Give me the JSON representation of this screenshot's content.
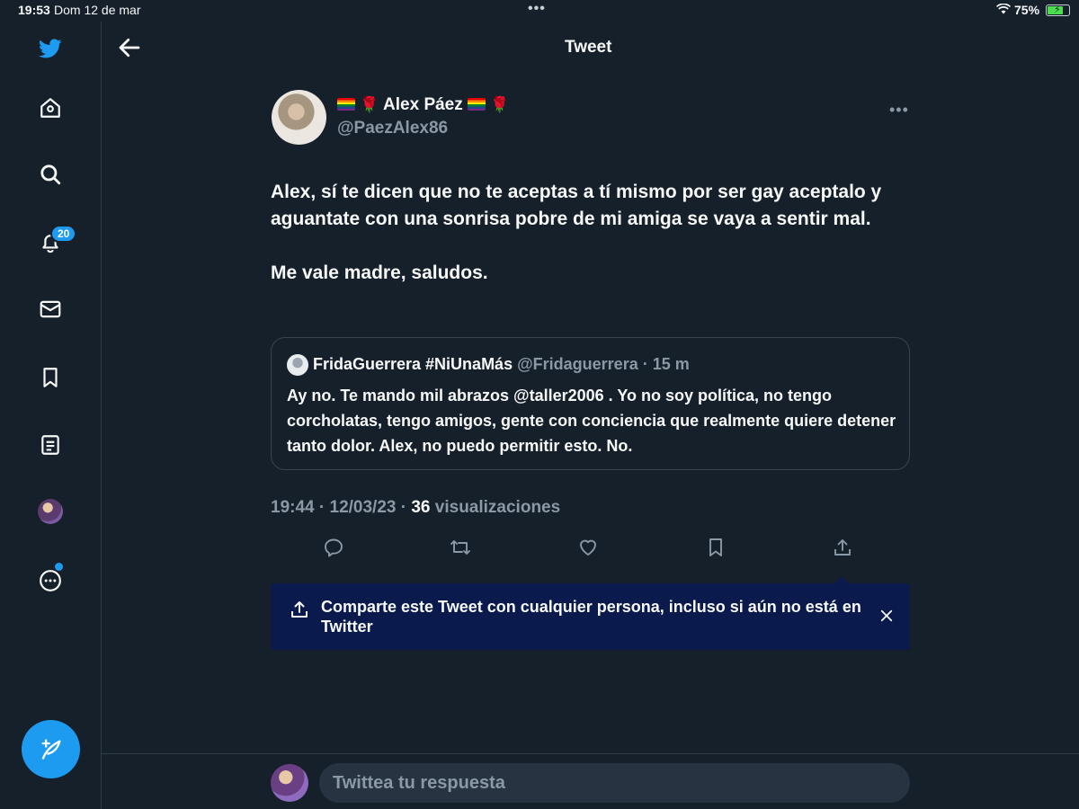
{
  "status_bar": {
    "time": "19:53",
    "date": "Dom 12 de mar",
    "battery_percent": "75%",
    "battery_level": 0.75
  },
  "sidebar": {
    "notification_count": "20"
  },
  "header": {
    "title": "Tweet"
  },
  "tweet": {
    "display_name": "Alex Páez",
    "handle": "@PaezAlex86",
    "text": "Alex, sí te dicen que no te aceptas a tí mismo por ser gay aceptalo y aguantate con una sonrisa pobre de mi amiga se vaya a sentir mal.\n\nMe vale madre, saludos.",
    "time": "19:44",
    "date": "12/03/23",
    "views_count": "36",
    "views_label": "visualizaciones"
  },
  "quoted_tweet": {
    "display_name": "FridaGuerrera #NiUnaMás",
    "handle": "@Fridaguerrera",
    "age": "15 m",
    "text": "Ay no. Te mando mil abrazos @taller2006 . Yo no soy política, no tengo corcholatas, tengo amigos, gente con conciencia que realmente quiere detener tanto dolor. Alex, no puedo permitir esto. No."
  },
  "share_banner": {
    "text": "Comparte este Tweet con cualquier persona, incluso si aún no está en Twitter"
  },
  "reply": {
    "placeholder": "Twittea tu respuesta"
  },
  "colors": {
    "background": "#15202b",
    "accent": "#1d9bf0",
    "secondary_text": "#8b98a5",
    "banner": "#0b1a4d"
  }
}
